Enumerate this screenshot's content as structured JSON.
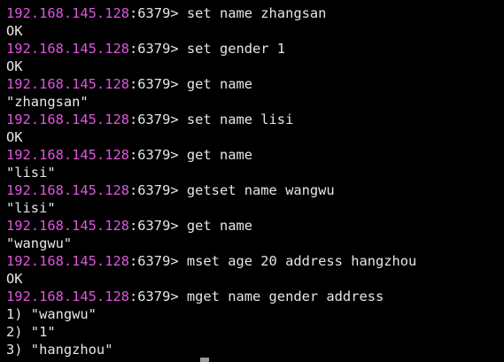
{
  "terminal": {
    "host": "192.168.145.128",
    "port_prompt": ":6379> ",
    "lines": [
      {
        "type": "prompt",
        "cmd": "set name zhangsan"
      },
      {
        "type": "output",
        "text": "OK"
      },
      {
        "type": "prompt",
        "cmd": "set gender 1"
      },
      {
        "type": "output",
        "text": "OK"
      },
      {
        "type": "prompt",
        "cmd": "get name"
      },
      {
        "type": "output",
        "text": "\"zhangsan\""
      },
      {
        "type": "prompt",
        "cmd": "set name lisi"
      },
      {
        "type": "output",
        "text": "OK"
      },
      {
        "type": "prompt",
        "cmd": "get name"
      },
      {
        "type": "output",
        "text": "\"lisi\""
      },
      {
        "type": "prompt",
        "cmd": "getset name wangwu"
      },
      {
        "type": "output",
        "text": "\"lisi\""
      },
      {
        "type": "prompt",
        "cmd": "get name"
      },
      {
        "type": "output",
        "text": "\"wangwu\""
      },
      {
        "type": "prompt",
        "cmd": "mset age 20 address hangzhou"
      },
      {
        "type": "output",
        "text": "OK"
      },
      {
        "type": "prompt",
        "cmd": "mget name gender address"
      },
      {
        "type": "output",
        "text": "1) \"wangwu\""
      },
      {
        "type": "output",
        "text": "2) \"1\""
      },
      {
        "type": "output",
        "text": "3) \"hangzhou\""
      }
    ]
  },
  "colors": {
    "background": "#000000",
    "text": "#e6e6e6",
    "host": "#e055e0",
    "cursor": "#9a9a9a"
  }
}
